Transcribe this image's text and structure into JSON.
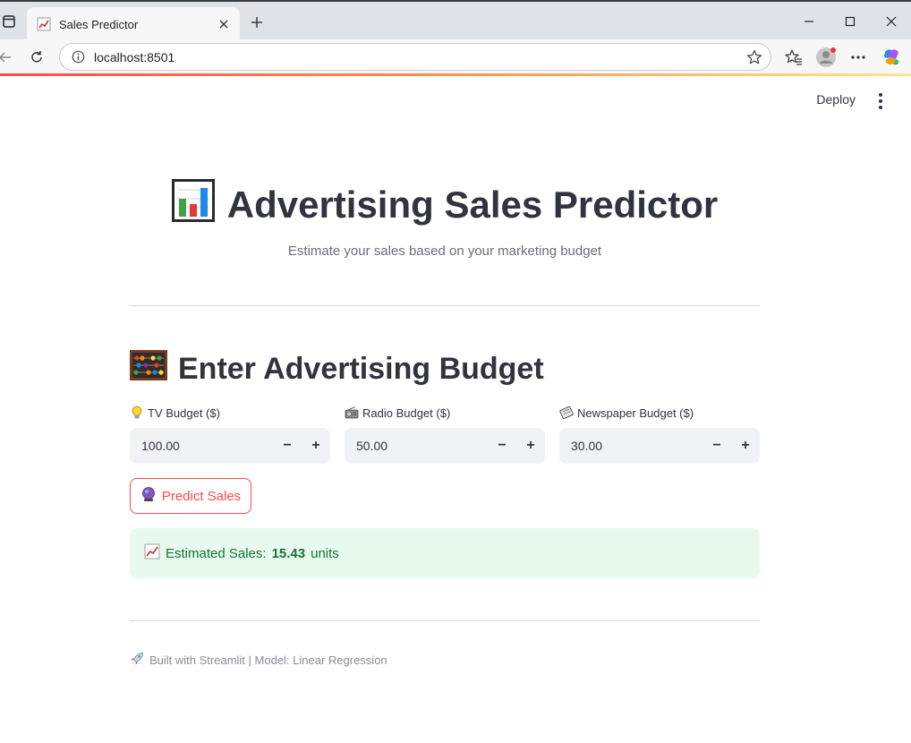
{
  "browser": {
    "tab_title": "Sales Predictor",
    "url": "localhost:8501",
    "icons": {
      "sidebar_toggle": "tab-actions-icon",
      "favicon": "chart-increasing-icon",
      "close": "close-icon",
      "new_tab": "plus-icon",
      "back": "back-arrow-icon",
      "refresh": "refresh-icon",
      "info": "info-icon",
      "favorite": "star-icon",
      "favorites": "favorites-icon",
      "profile": "profile-icon",
      "more": "more-icon",
      "copilot": "copilot-icon"
    },
    "accent": "#ff4b4b"
  },
  "header": {
    "deploy_label": "Deploy"
  },
  "hero": {
    "icon": "bar-chart-icon",
    "title": "Advertising Sales Predictor",
    "subtitle": "Estimate your sales based on your marketing budget"
  },
  "section": {
    "icon": "abacus-icon",
    "title": "Enter Advertising Budget"
  },
  "inputs": [
    {
      "icon": "light-bulb-icon",
      "label": "TV Budget ($)",
      "value": "100.00"
    },
    {
      "icon": "radio-icon",
      "label": "Radio Budget ($)",
      "value": "50.00"
    },
    {
      "icon": "newspaper-icon",
      "label": "Newspaper Budget ($)",
      "value": "30.00"
    }
  ],
  "stepper": {
    "minus": "−",
    "plus": "+"
  },
  "predict": {
    "icon": "crystal-ball-icon",
    "label": "Predict Sales"
  },
  "result": {
    "icon": "chart-increasing-icon",
    "prefix": "Estimated Sales:",
    "value": "15.43",
    "suffix": "units",
    "color": "#177233",
    "background": "#e8f9ee"
  },
  "footer": {
    "icon": "rocket-icon",
    "text": "Built with Streamlit | Model: Linear Regression"
  }
}
